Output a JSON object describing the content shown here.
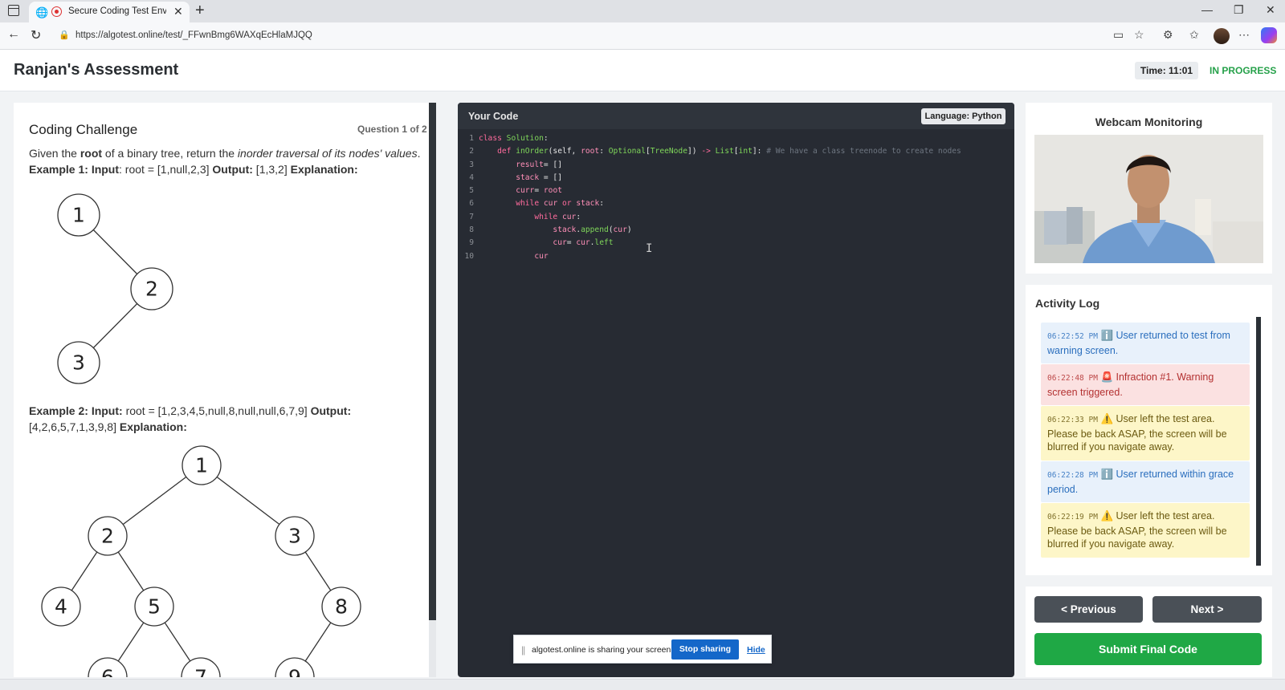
{
  "browser": {
    "tab_title": "Secure Coding Test Environment",
    "url": "https://algotest.online/test/_FFwnBmg6WAXqEcHlaMJQQ"
  },
  "header": {
    "title": "Ranjan's Assessment",
    "timer": "Time: 11:01",
    "status": "IN PROGRESS",
    "status_color": "#26a14a"
  },
  "problem": {
    "title": "Coding Challenge",
    "counter": "Question 1 of 2",
    "text_p1": "Given the ",
    "text_b1": "root",
    "text_p2": " of a binary tree, return the ",
    "text_i1": "inorder traversal of its nodes' values",
    "text_p3": ". ",
    "text_b2": "Example 1: Input",
    "text_p4": ": root = [1,null,2,3] ",
    "text_b3": "Output:",
    "text_p5": " [1,3,2] ",
    "text_b4": "Explanation:",
    "ex2_b1": "Example 2: Input:",
    "ex2_p1": " root = [1,2,3,4,5,null,8,null,null,6,7,9] ",
    "ex2_b2": "Output:",
    "ex2_p2": " [4,2,6,5,7,1,3,9,8] ",
    "ex2_b3": "Explanation:",
    "tree1_nodes": [
      "1",
      "2",
      "3"
    ],
    "tree2_nodes": [
      "1",
      "2",
      "3",
      "4",
      "5",
      "8",
      "6",
      "7",
      "9"
    ]
  },
  "editor": {
    "title": "Your Code",
    "language": "Language: Python",
    "comment": "# We have a class treenode to create nodes"
  },
  "share_bar": {
    "text": "algotest.online is sharing your screen.",
    "stop": "Stop sharing",
    "hide": "Hide"
  },
  "webcam": {
    "title": "Webcam Monitoring"
  },
  "activity_log": {
    "title": "Activity Log",
    "entries": [
      {
        "time": "06:22:52 PM",
        "icon": "ℹ️",
        "text": "User returned to test from warning screen.",
        "kind": "info"
      },
      {
        "time": "06:22:48 PM",
        "icon": "🚨",
        "text": "Infraction #1. Warning screen triggered.",
        "kind": "danger"
      },
      {
        "time": "06:22:33 PM",
        "icon": "⚠️",
        "text": "User left the test area. Please be back ASAP, the screen will be blurred if you navigate away.",
        "kind": "warn"
      },
      {
        "time": "06:22:28 PM",
        "icon": "ℹ️",
        "text": "User returned within grace period.",
        "kind": "info"
      },
      {
        "time": "06:22:19 PM",
        "icon": "⚠️",
        "text": "User left the test area. Please be back ASAP, the screen will be blurred if you navigate away.",
        "kind": "warn"
      }
    ]
  },
  "nav": {
    "previous": "< Previous",
    "next": "Next >",
    "submit": "Submit Final Code"
  }
}
